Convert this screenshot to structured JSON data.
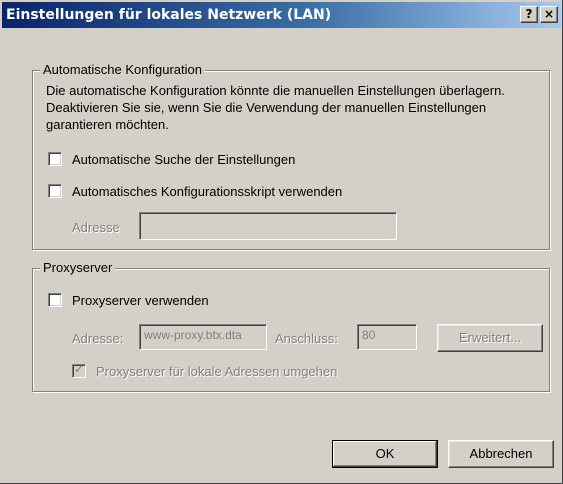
{
  "window": {
    "title": "Einstellungen für lokales Netzwerk (LAN)",
    "help_glyph": "?",
    "close_glyph": "×"
  },
  "auto_config": {
    "legend": "Automatische Konfiguration",
    "description": "Die automatische Konfiguration könnte die manuellen Einstellungen überlagern. Deaktivieren Sie sie, wenn Sie die Verwendung der manuellen Einstellungen garantieren möchten.",
    "auto_detect": {
      "label": "Automatische Suche der Einstellungen",
      "checked": false
    },
    "use_script": {
      "label": "Automatisches Konfigurationsskript verwenden",
      "checked": false
    },
    "address_label": "Adresse",
    "address_value": ""
  },
  "proxy": {
    "legend": "Proxyserver",
    "use_proxy": {
      "label": "Proxyserver verwenden",
      "checked": false
    },
    "address_label": "Adresse:",
    "address_value": "www-proxy.btx.dta",
    "port_label": "Anschluss:",
    "port_value": "80",
    "advanced_label": "Erweitert...",
    "bypass_local": {
      "label": "Proxyserver für lokale Adressen umgehen",
      "checked": true,
      "check_glyph": "✓"
    }
  },
  "buttons": {
    "ok_label": "OK",
    "cancel_label": "Abbrechen"
  },
  "colors": {
    "face": "#d4d0c8",
    "title_start": "#0a246a",
    "title_end": "#a6caf0",
    "disabled_text": "#808080"
  }
}
